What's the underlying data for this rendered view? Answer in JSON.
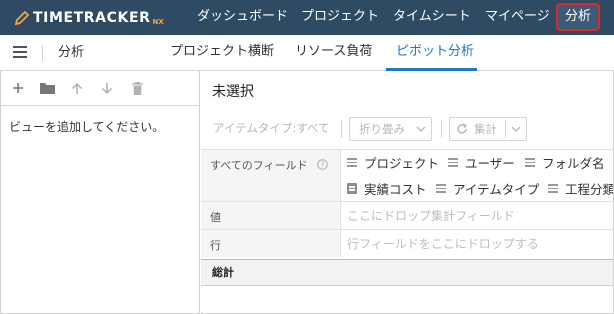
{
  "app": {
    "logo_text": "TIMETRACKER",
    "logo_sub": "NX"
  },
  "topnav": {
    "items": [
      "ダッシュボード",
      "プロジェクト",
      "タイムシート",
      "マイページ"
    ],
    "active": "分析"
  },
  "subbar": {
    "title": "分析",
    "tabs": [
      "プロジェクト横断",
      "リソース負荷",
      "ピボット分析"
    ],
    "active_tab": "ピボット分析"
  },
  "left": {
    "toolbar_icons": [
      "add-icon",
      "folder-icon",
      "arrow-up-icon",
      "arrow-down-icon",
      "trash-icon"
    ],
    "empty_message": "ビューを追加してください。"
  },
  "right": {
    "title": "未選択",
    "toolbar": {
      "item_type": "アイテムタイプ:すべて",
      "fold": "折り畳み",
      "aggregate": "集計"
    },
    "rows": {
      "all_fields_label": "すべてのフィールド",
      "value_label": "値",
      "value_placeholder": "ここにドロップ集計フィールド",
      "row_label": "行",
      "row_placeholder": "行フィールドをここにドロップする",
      "totals_label": "総計"
    },
    "fields_line1": [
      "プロジェクト",
      "ユーザー",
      "フォルダ名"
    ],
    "fields_line2": [
      {
        "label": "実績コスト",
        "kind": "numeric"
      },
      {
        "label": "アイテムタイプ",
        "kind": "text"
      },
      {
        "label": "工程分類",
        "kind": "text"
      }
    ]
  },
  "colors": {
    "topbar": "#2f4a63",
    "accent": "#1e78c8",
    "highlight_border": "#e02828",
    "logo_accent": "#f2a33a"
  }
}
